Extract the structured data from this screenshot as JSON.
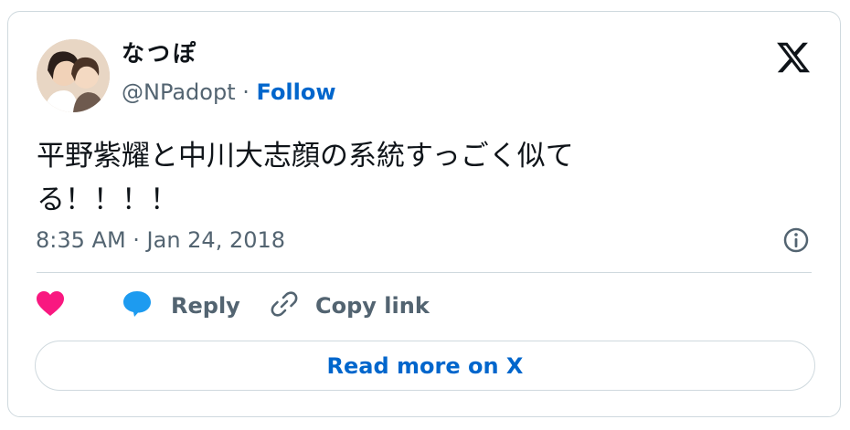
{
  "user": {
    "display_name": "なつぽ",
    "handle": "@NPadopt",
    "separator": " · ",
    "follow_label": "Follow"
  },
  "tweet": {
    "text": "平野紫耀と中川大志顔の系統すっごく似て\nる！！！！",
    "timestamp": "8:35 AM · Jan 24, 2018"
  },
  "actions": {
    "reply_label": "Reply",
    "copy_link_label": "Copy link"
  },
  "read_more_label": "Read more on X",
  "icons": [
    "heart-icon",
    "reply-icon",
    "link-icon",
    "info-icon",
    "x-logo-icon"
  ],
  "colors": {
    "heart": "#f91880",
    "reply": "#1d9bf0",
    "link": "#0066cc",
    "muted": "#536471",
    "border": "#cfd9de"
  }
}
